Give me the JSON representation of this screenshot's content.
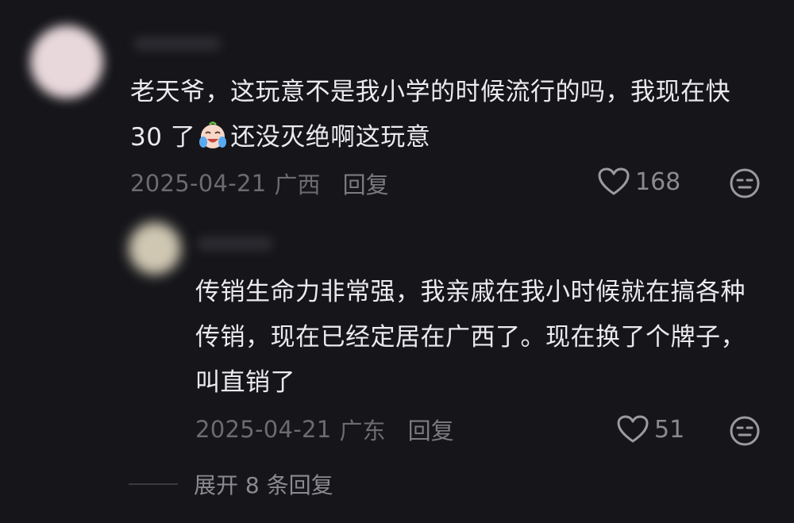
{
  "comments": [
    {
      "text_before": "老天爷，这玩意不是我小学的时候流行的吗，我现在快 30 了",
      "emoji": "crying-laughing-face-emoji",
      "text_after": "还没灭绝啊这玩意",
      "date": "2025-04-21",
      "location": "广西",
      "reply_label": "回复",
      "likes": "168"
    },
    {
      "text": "传销生命力非常强，我亲戚在我小时候就在搞各种传销，现在已经定居在广西了。现在换了个牌子，叫直销了",
      "date": "2025-04-21",
      "location": "广东",
      "reply_label": "回复",
      "likes": "51"
    }
  ],
  "expand_replies": "展开 8 条回复",
  "colors": {
    "background": "#16161a",
    "text": "#ebebee",
    "meta": "#6b6b70"
  }
}
